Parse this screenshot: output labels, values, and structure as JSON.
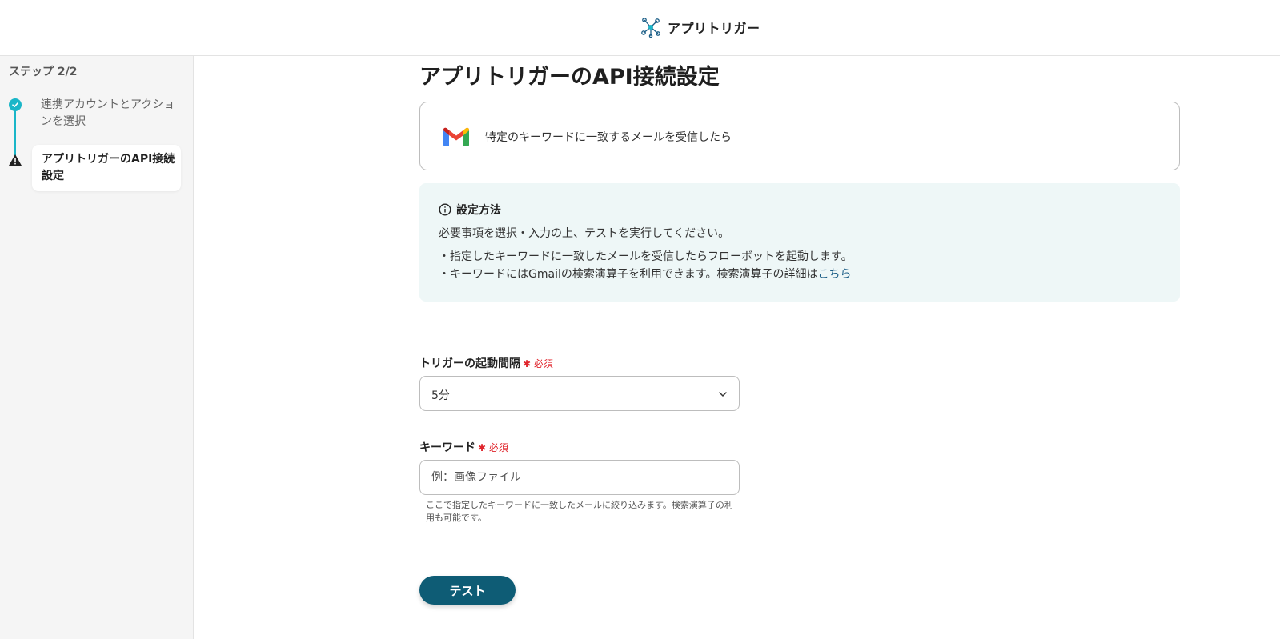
{
  "header": {
    "brand": "アプリトリガー"
  },
  "sidebar": {
    "step_count": "ステップ 2/2",
    "steps": [
      {
        "label": "連携アカウントとアクションを選択",
        "status": "done"
      },
      {
        "label": "アプリトリガーのAPI接続設定",
        "status": "current-warning"
      }
    ]
  },
  "main": {
    "title": "アプリトリガーのAPI接続設定",
    "trigger": {
      "app_icon": "gmail-icon",
      "label": "特定のキーワードに一致するメールを受信したら"
    },
    "info": {
      "title": "設定方法",
      "line1": "必要事項を選択・入力の上、テストを実行してください。",
      "line2": "・指定したキーワードに一致したメールを受信したらフローボットを起動します。",
      "line3": "・キーワードにはGmailの検索演算子を利用できます。検索演算子の詳細は",
      "link": "こちら"
    },
    "interval_field": {
      "label": "トリガーの起動間隔",
      "required": "必須",
      "value": "5分"
    },
    "keyword_field": {
      "label": "キーワード",
      "required": "必須",
      "placeholder": "例：画像ファイル",
      "help": "ここで指定したキーワードに一致したメールに絞り込みます。検索演算子の利用も可能です。"
    },
    "test_button": "テスト"
  },
  "colors": {
    "accent": "#1ab6c8",
    "button": "#0e5c75",
    "required": "#e0252c",
    "info_bg": "#eef7f7",
    "link": "#1a5d86"
  }
}
